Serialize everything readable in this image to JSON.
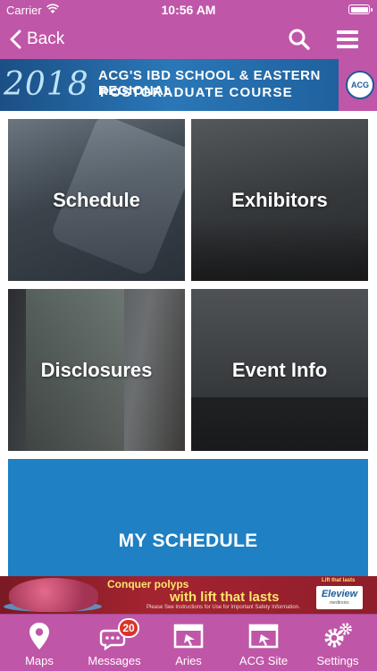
{
  "status_bar": {
    "carrier": "Carrier",
    "time": "10:56 AM"
  },
  "nav": {
    "back_label": "Back",
    "search_icon": "search-icon",
    "menu_icon": "hamburger-menu-icon"
  },
  "banner": {
    "year": "2018",
    "line1": "ACG'S IBD SCHOOL & EASTERN REGIONAL",
    "line2": "POSTGRADUATE COURSE",
    "logo_text": "ACG"
  },
  "tiles": [
    {
      "label": "Schedule"
    },
    {
      "label": "Exhibitors"
    },
    {
      "label": "Disclosures"
    },
    {
      "label": "Event Info"
    }
  ],
  "my_schedule": {
    "label": "MY SCHEDULE"
  },
  "ad": {
    "headline1": "Conquer polyps",
    "headline2": "with lift that lasts",
    "fine_print": "Please See Instructions for Use for Important Safety Information.",
    "tagline": "Lift that lasts",
    "brand": "Eleview",
    "brand_sub": "medtronic"
  },
  "tabbar": {
    "items": [
      {
        "label": "Maps",
        "icon": "map-pin-icon"
      },
      {
        "label": "Messages",
        "icon": "chat-bubbles-icon",
        "badge": "20"
      },
      {
        "label": "Aries",
        "icon": "browser-window-icon"
      },
      {
        "label": "ACG Site",
        "icon": "browser-window-icon"
      },
      {
        "label": "Settings",
        "icon": "gears-icon"
      }
    ]
  },
  "colors": {
    "accent": "#c056a8",
    "banner_blue": "#1f80c3",
    "ad_red": "#a32430",
    "badge": "#d9342b"
  }
}
